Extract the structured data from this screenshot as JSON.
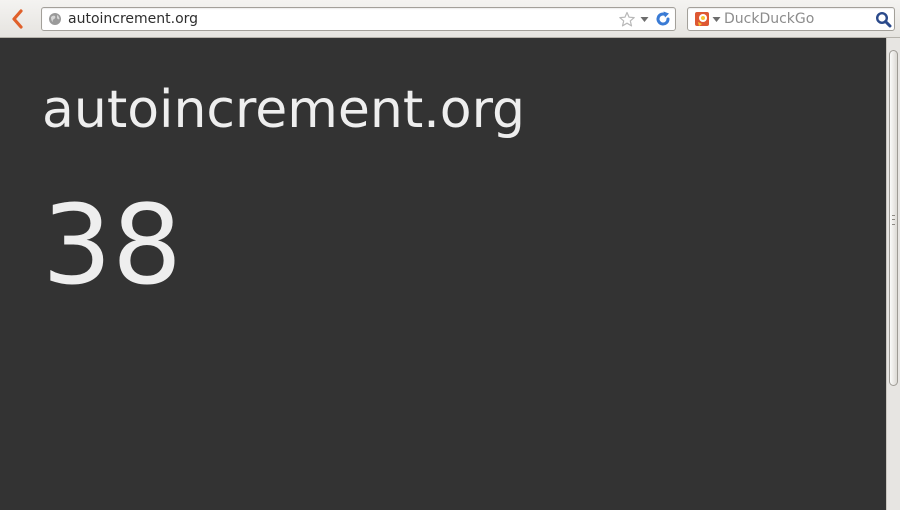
{
  "browser": {
    "url": "autoincrement.org",
    "search_placeholder": "DuckDuckGo",
    "icons": {
      "back": "back-arrow-icon",
      "site": "globe-icon",
      "bookmark": "star-icon",
      "history": "chevron-down-icon",
      "reload": "reload-icon",
      "engine": "duckduckgo-icon",
      "search": "magnifier-icon"
    },
    "colors": {
      "back_arrow": "#e0602a",
      "reload": "#3a7bd5",
      "search_go": "#2b4a8b"
    }
  },
  "page": {
    "title": "autoincrement.org",
    "count": "38",
    "colors": {
      "background": "#333333",
      "text": "#eeeeee"
    }
  }
}
